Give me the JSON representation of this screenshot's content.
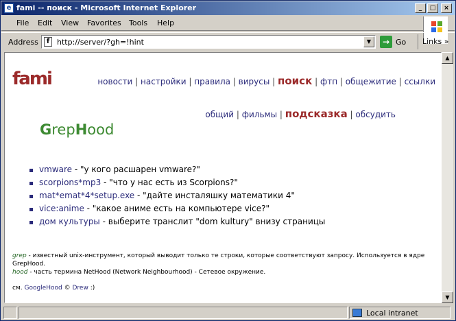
{
  "window": {
    "title": "fami -- поиск - Microsoft Internet Explorer"
  },
  "menubar": [
    "File",
    "Edit",
    "View",
    "Favorites",
    "Tools",
    "Help"
  ],
  "address": {
    "label": "Address",
    "url": "http://server/?gh=!hint",
    "go_label": "Go",
    "links_label": "Links"
  },
  "page": {
    "logo": "fami",
    "nav_main": [
      "новости",
      "настройки",
      "правила",
      "вирусы",
      "поиск",
      "фтп",
      "общежитие",
      "ссылки"
    ],
    "nav_sub": [
      "общий",
      "фильмы",
      "подсказка",
      "обсудить"
    ],
    "grephood_logo": {
      "g": "G",
      "rep": "rep",
      "h": "H",
      "ood": "ood"
    },
    "hints": [
      {
        "query": "vmware",
        "desc": "- \"у кого расшарен vmware?\""
      },
      {
        "query": "scorpions*mp3",
        "desc": "- \"что у нас есть из Scorpions?\""
      },
      {
        "query": "mat*emat*4*setup.exe",
        "desc": "- \"дайте инсталяшку математики 4\""
      },
      {
        "query": "vice:anime",
        "desc": "- \"какое аниме есть на компьютере vice?\""
      },
      {
        "query": "дом культуры",
        "desc": "- выберите транслит \"dom kultury\" внизу страницы"
      }
    ],
    "notes": {
      "grep_term": "grep",
      "grep_text": "- известный unix-инструмент, который выводит только те строки, которые соответствуют запросу. Используется в ядре GrepHood.",
      "hood_term": "hood",
      "hood_text": "- часть термина NetHood (Network Neighbourhood) - Сетевое окружение."
    },
    "see_also": {
      "prefix": "см.",
      "link1": "GoogleHood",
      "copy": "©",
      "link2": "Drew",
      "suffix": ":)"
    }
  },
  "status": {
    "zone": "Local intranet"
  },
  "colors": {
    "accent": "#9b2a2a",
    "link": "#2a2a7a",
    "grephood": "#3d8a32",
    "titlebar_start": "#0a246a",
    "titlebar_end": "#a6caf0"
  }
}
